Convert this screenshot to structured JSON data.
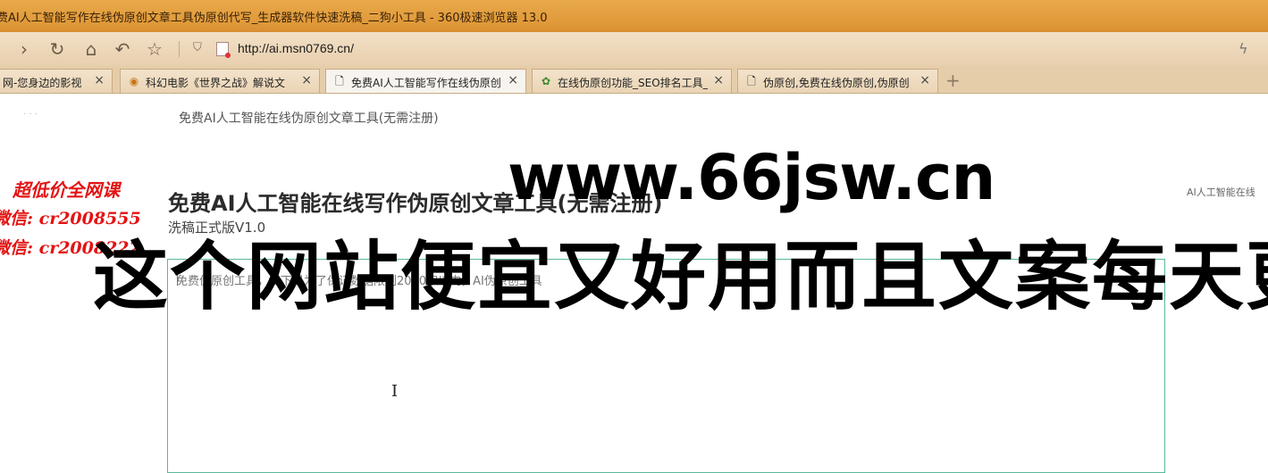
{
  "window": {
    "title": "费AI人工智能写作在线伪原创文章工具伪原创代写_生成器软件快速洗稿_二狗小工具 - 360极速浏览器 13.0"
  },
  "toolbar": {
    "url": "http://ai.msn0769.cn/"
  },
  "tabs": [
    {
      "label": "网-您身边的影视",
      "active": false
    },
    {
      "label": "科幻电影《世界之战》解说文",
      "active": false
    },
    {
      "label": "免费AI人工智能写作在线伪原创",
      "active": true
    },
    {
      "label": "在线伪原创功能_SEO排名工具_",
      "active": false
    },
    {
      "label": "伪原创,免费在线伪原创,伪原创",
      "active": false
    }
  ],
  "page": {
    "subheading": "免费AI人工智能在线伪原创文章工具(无需注册)",
    "heading": "免费AI人工智能在线写作伪原创文章工具(无需注册)",
    "version": "洗稿正式版V1.0",
    "right_link": "AI人工智能在线",
    "textarea_placeholder": "免费伪原创工具，以下是为了保证数据限制2000字以内，AI伪原创工具"
  },
  "overlay": {
    "promo_line1": "超低价全网课",
    "promo_line2": "微信:  cr2008555",
    "promo_line3": "微信:  cr2008222",
    "watermark_url": "www.66jsw.cn",
    "watermark_text": "这个网站便宜又好用而且文案每天更"
  }
}
